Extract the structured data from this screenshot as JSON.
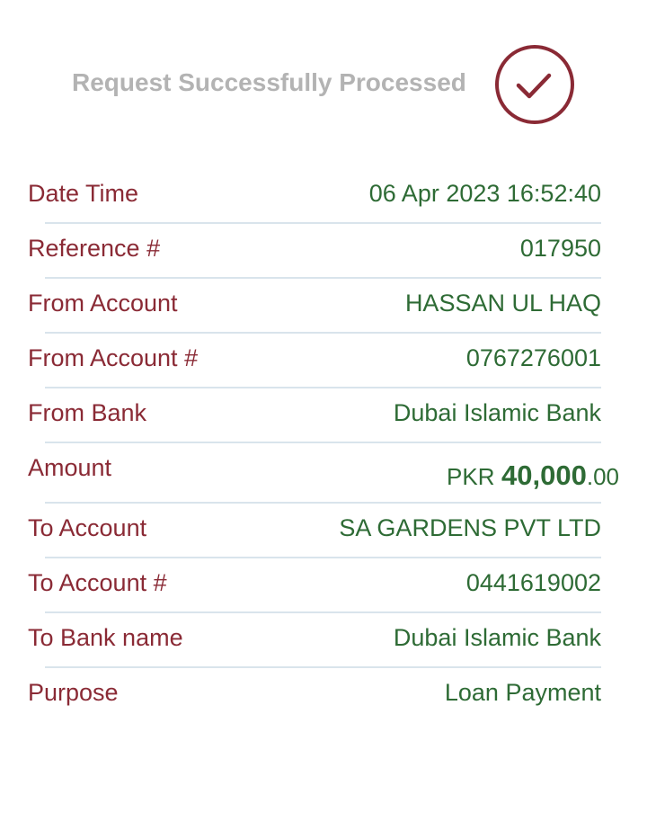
{
  "header": {
    "title": "Request Successfully Processed",
    "status_icon": "check-circle-icon",
    "accent_color": "#8a2a35"
  },
  "colors": {
    "label": "#8a2a35",
    "value": "#2e6b35",
    "title": "#b3b3b3",
    "divider": "#d9e4ec"
  },
  "details": {
    "date_time": {
      "label": "Date Time",
      "value": "06 Apr 2023 16:52:40"
    },
    "reference": {
      "label": "Reference #",
      "value": "017950"
    },
    "from_account": {
      "label": "From Account",
      "value": "HASSAN UL HAQ"
    },
    "from_account_no": {
      "label": "From Account #",
      "value": "0767276001"
    },
    "from_bank": {
      "label": "From Bank",
      "value": "Dubai Islamic Bank"
    },
    "amount": {
      "label": "Amount",
      "currency": "PKR",
      "major": "40,000",
      "minor": ".00"
    },
    "to_account": {
      "label": "To Account",
      "value": "SA GARDENS PVT LTD"
    },
    "to_account_no": {
      "label": "To Account #",
      "value": "0441619002"
    },
    "to_bank": {
      "label": "To Bank name",
      "value": "Dubai Islamic Bank"
    },
    "purpose": {
      "label": "Purpose",
      "value": "Loan Payment"
    }
  }
}
